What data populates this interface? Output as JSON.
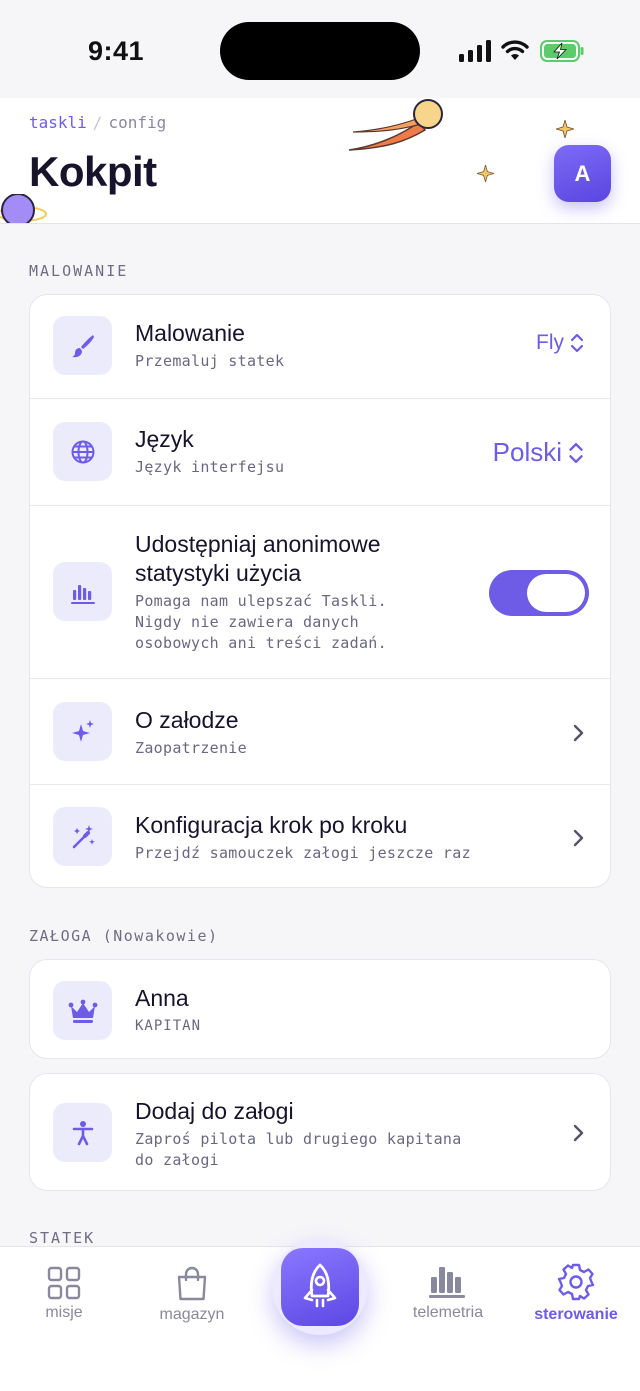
{
  "status_bar": {
    "time": "9:41"
  },
  "header": {
    "breadcrumb_root": "taskli",
    "breadcrumb_separator": "/",
    "breadcrumb_current": "config",
    "title": "Kokpit",
    "avatar_initial": "A"
  },
  "sections": {
    "painting_label": "MALOWANIE",
    "crew_label": "ZAŁOGA (Nowakowie)",
    "ship_label": "STATEK"
  },
  "settings": {
    "theme": {
      "title": "Malowanie",
      "subtitle": "Przemaluj statek",
      "value": "Fly",
      "icon": "paintbrush-icon"
    },
    "language": {
      "title": "Język",
      "subtitle": "Język interfejsu",
      "value": "Polski",
      "icon": "globe-icon"
    },
    "analytics": {
      "title_line1": "Udostępniaj anonimowe",
      "title_line2": "statystyki użycia",
      "subtitle_line1": "Pomaga nam ulepszać Taskli.",
      "subtitle_line2": "Nigdy nie zawiera danych",
      "subtitle_line3": "osobowych ani treści zadań.",
      "enabled": true,
      "icon": "bar-chart-icon"
    },
    "about": {
      "title": "O załodze",
      "subtitle": "Zaopatrzenie",
      "icon": "sparkles-icon"
    },
    "onboarding": {
      "title": "Konfiguracja krok po kroku",
      "subtitle": "Przejdź samouczek załogi jeszcze raz",
      "icon": "magic-wand-icon"
    }
  },
  "crew": {
    "member": {
      "name": "Anna",
      "role": "KAPITAN",
      "icon": "crown-icon"
    },
    "add": {
      "title": "Dodaj do załogi",
      "subtitle_line1": "Zaproś pilota lub drugiego kapitana",
      "subtitle_line2": "do załogi",
      "icon": "person-icon"
    }
  },
  "nav": {
    "missions": "misje",
    "storage": "magazyn",
    "telemetry": "telemetria",
    "controls": "sterowanie",
    "active": "controls"
  },
  "colors": {
    "accent": "#6e5ce6",
    "icon_bg": "#ecebfc",
    "background": "#f6f6f9"
  }
}
